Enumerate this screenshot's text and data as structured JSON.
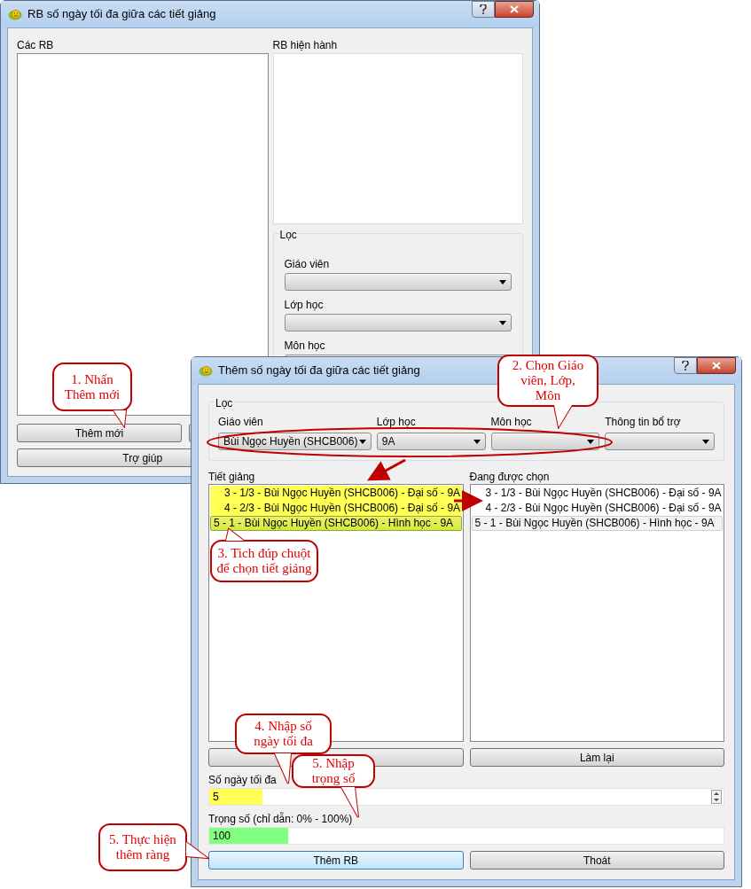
{
  "main_window": {
    "title": "RB số ngày tối đa giữa các tiết giảng",
    "list_label": "Các RB",
    "current_label": "RB hiện hành",
    "filter": {
      "title": "Lọc",
      "fields": [
        {
          "label": "Giáo viên"
        },
        {
          "label": "Lớp học"
        },
        {
          "label": "Môn học"
        }
      ]
    },
    "buttons": [
      {
        "label": "Thêm mới",
        "kind": "half"
      },
      {
        "label": "Trợ giúp",
        "kind": "wide"
      }
    ]
  },
  "dialog": {
    "title": "Thêm số ngày tối đa giữa các tiết giảng",
    "filter": {
      "title": "Lọc",
      "fields": [
        {
          "label": "Giáo viên",
          "value": "Bùi Ngọc Huyền (SHCB006)"
        },
        {
          "label": "Lớp học",
          "value": "9A"
        },
        {
          "label": "Môn học"
        },
        {
          "label": "Thông tin bổ trợ"
        }
      ]
    },
    "lessons": {
      "label": "Tiết giảng",
      "items": [
        {
          "text": "3 - 1/3 - Bùi Ngọc Huyền (SHCB006) - Đại số - 9A",
          "kind": "part",
          "highlighted": true,
          "selected": false
        },
        {
          "text": "4 - 2/3 - Bùi Ngọc Huyền (SHCB006) - Đại số - 9A",
          "kind": "part",
          "highlighted": true,
          "selected": false
        },
        {
          "text": "5 - 1 - Bùi Ngọc Huyền (SHCB006) - Hình học - 9A",
          "kind": "whole",
          "highlighted": true,
          "selected": true
        }
      ]
    },
    "chosen": {
      "label": "Đang được chọn",
      "items": [
        {
          "text": "3 - 1/3 - Bùi Ngọc Huyền (SHCB006) - Đại số - 9A",
          "kind": "part",
          "selected": false
        },
        {
          "text": "4 - 2/3 - Bùi Ngọc Huyền (SHCB006) - Đại số - 9A",
          "kind": "part",
          "selected": false
        },
        {
          "text": "5 - 1 - Bùi Ngọc Huyền (SHCB006) - Hình học - 9A",
          "kind": "whole",
          "selected": true
        }
      ]
    },
    "reset_button": "Làm lại",
    "max_days": {
      "label": "Số ngày tối đa",
      "value": "5"
    },
    "weight": {
      "label": "Trọng số (chỉ dẫn: 0% - 100%)",
      "value": "100"
    },
    "buttons": [
      {
        "label": "Thêm RB",
        "focused": true
      },
      {
        "label": "Thoát",
        "focused": false
      }
    ]
  },
  "callouts": [
    "1. Nhấn\nThêm mới",
    "2. Chọn Giáo\nviên, Lớp,\nMôn",
    "3. Tich đúp chuột\nđể chọn tiết giảng",
    "4. Nhập số\nngày tối đa",
    "5. Nhập\ntrọng số",
    "5. Thực hiện\nthêm ràng"
  ]
}
